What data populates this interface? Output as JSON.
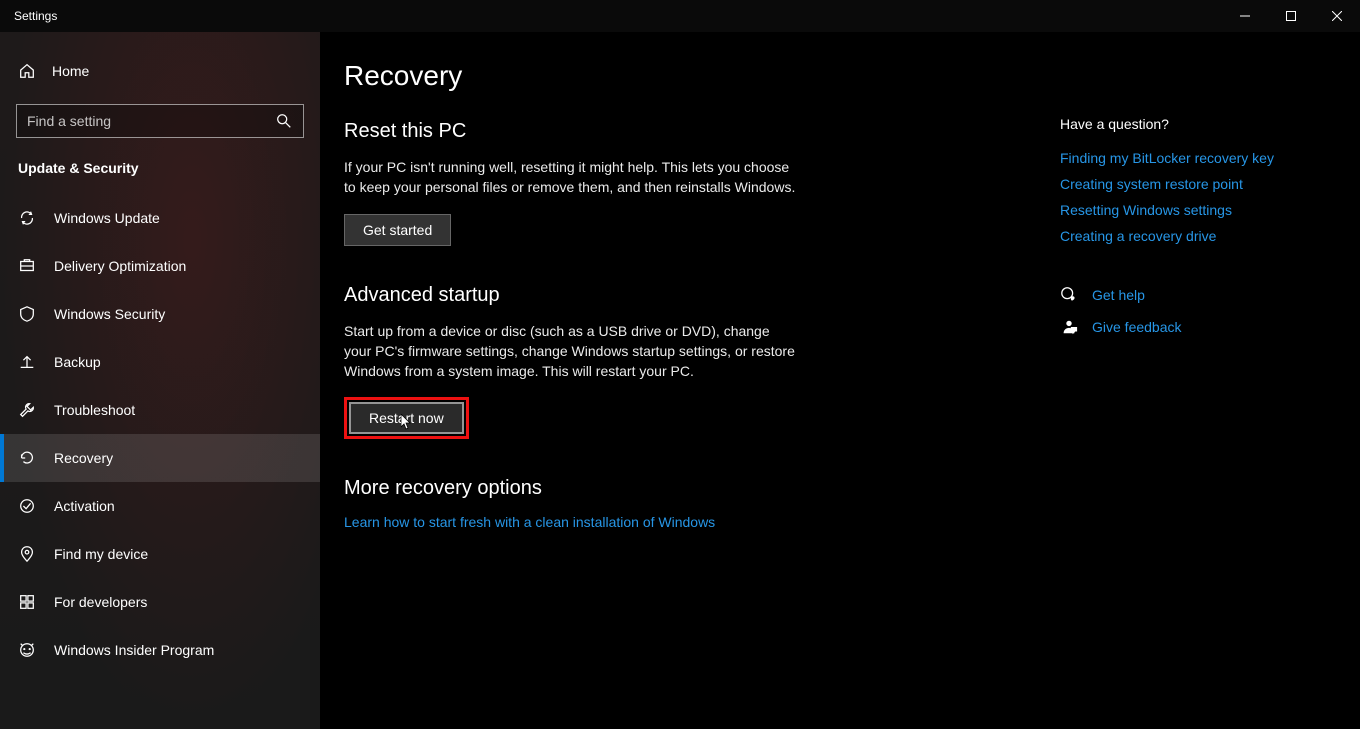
{
  "window_title": "Settings",
  "home": "Home",
  "search_placeholder": "Find a setting",
  "category": "Update & Security",
  "nav": [
    {
      "label": "Windows Update"
    },
    {
      "label": "Delivery Optimization"
    },
    {
      "label": "Windows Security"
    },
    {
      "label": "Backup"
    },
    {
      "label": "Troubleshoot"
    },
    {
      "label": "Recovery"
    },
    {
      "label": "Activation"
    },
    {
      "label": "Find my device"
    },
    {
      "label": "For developers"
    },
    {
      "label": "Windows Insider Program"
    }
  ],
  "page": {
    "title": "Recovery",
    "reset": {
      "heading": "Reset this PC",
      "desc": "If your PC isn't running well, resetting it might help. This lets you choose to keep your personal files or remove them, and then reinstalls Windows.",
      "button": "Get started"
    },
    "advanced": {
      "heading": "Advanced startup",
      "desc": "Start up from a device or disc (such as a USB drive or DVD), change your PC's firmware settings, change Windows startup settings, or restore Windows from a system image. This will restart your PC.",
      "button": "Restart now"
    },
    "more": {
      "heading": "More recovery options",
      "link": "Learn how to start fresh with a clean installation of Windows"
    }
  },
  "right": {
    "question": "Have a question?",
    "links": [
      "Finding my BitLocker recovery key",
      "Creating system restore point",
      "Resetting Windows settings",
      "Creating a recovery drive"
    ],
    "help": "Get help",
    "feedback": "Give feedback"
  }
}
